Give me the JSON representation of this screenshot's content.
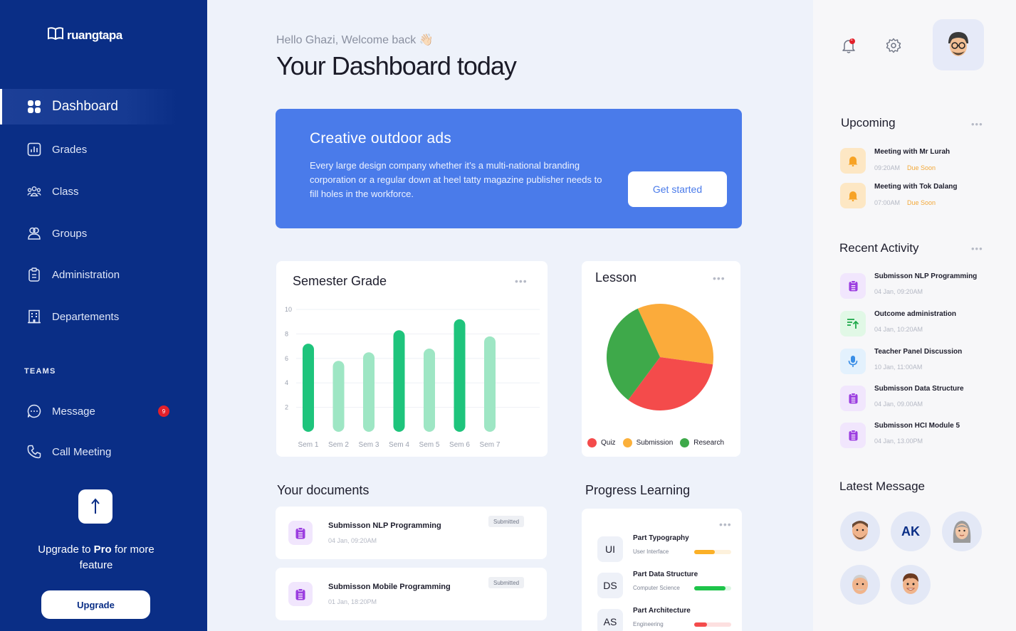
{
  "app": {
    "logo_text": "ruangtapa"
  },
  "sidebar": {
    "items": [
      {
        "label": "Dashboard",
        "icon": "grid-icon",
        "active": true
      },
      {
        "label": "Grades",
        "icon": "bar-chart-icon"
      },
      {
        "label": "Class",
        "icon": "people-icon"
      },
      {
        "label": "Groups",
        "icon": "users-icon"
      },
      {
        "label": "Administration",
        "icon": "clipboard-icon"
      },
      {
        "label": "Departements",
        "icon": "building-icon"
      }
    ],
    "teams_label": "TEAMS",
    "teams": [
      {
        "label": "Message",
        "icon": "chat-icon",
        "badge": "9"
      },
      {
        "label": "Call Meeting",
        "icon": "phone-icon"
      }
    ],
    "upgrade": {
      "text_prefix": "Upgrade to ",
      "text_bold": "Pro",
      "text_suffix": " for more feature",
      "button": "Upgrade"
    }
  },
  "header": {
    "greeting": "Hello Ghazi, Welcome back 👋🏻",
    "title": "Your Dashboard today"
  },
  "banner": {
    "title": "Creative outdoor ads",
    "body": "Every large design company whether it’s a multi-national branding corporation or a regular down at heel tatty magazine publisher needs to fill holes in the workforce.",
    "button": "Get started",
    "color": "#4a7bea"
  },
  "semester_card": {
    "title": "Semester Grade"
  },
  "lesson_card": {
    "title": "Lesson",
    "legend": [
      {
        "label": "Quiz",
        "color": "#f44b4b"
      },
      {
        "label": "Submission",
        "color": "#fbb03b"
      },
      {
        "label": "Research",
        "color": "#3ea94a"
      }
    ]
  },
  "chart_data": [
    {
      "type": "bar",
      "title": "Semester Grade",
      "categories": [
        "Sem 1",
        "Sem 2",
        "Sem 3",
        "Sem 4",
        "Sem 5",
        "Sem 6",
        "Sem 7"
      ],
      "values": [
        7.2,
        5.8,
        6.5,
        8.3,
        6.8,
        9.2,
        7.8
      ],
      "yticks": [
        2,
        4,
        6,
        8,
        10
      ],
      "ylim": [
        0,
        10
      ],
      "bar_colors": [
        "#1ec47c",
        "#9ee6c4",
        "#9ee6c4",
        "#1ec47c",
        "#9ee6c4",
        "#1ec47c",
        "#9ee6c4"
      ],
      "grid": true
    },
    {
      "type": "pie",
      "title": "Lesson",
      "labels": [
        "Submission",
        "Quiz",
        "Research"
      ],
      "values": [
        34,
        33,
        33
      ],
      "colors": [
        "#fbab3b",
        "#f44b4b",
        "#3ea94a"
      ],
      "legend_position": "bottom"
    }
  ],
  "documents": {
    "title": "Your documents",
    "items": [
      {
        "name": "Submisson NLP Programming",
        "date": "04 Jan, 09:20AM",
        "status": "Submitted"
      },
      {
        "name": "Submisson Mobile Programming",
        "date": "01 Jan, 18:20PM",
        "status": "Submitted"
      }
    ]
  },
  "progress": {
    "title": "Progress Learning",
    "items": [
      {
        "abbr": "UI",
        "name": "Part Typography",
        "sub": "User Interface",
        "progress": 0.55,
        "color": "#fbb027",
        "track": "#fdf1dc"
      },
      {
        "abbr": "DS",
        "name": "Part Data Structure",
        "sub": "Computer Science",
        "progress": 0.85,
        "color": "#1ec44a",
        "track": "#dcf7e3"
      },
      {
        "abbr": "AS",
        "name": "Part Architecture",
        "sub": "Engineering",
        "progress": 0.35,
        "color": "#f44b4b",
        "track": "#fde0e0"
      }
    ]
  },
  "right": {
    "notification_badge": "1",
    "upcoming": {
      "title": "Upcoming",
      "items": [
        {
          "name": "Meeting with Mr Lurah",
          "time": "09:20AM",
          "due": "Due Soon"
        },
        {
          "name": "Meeting with Tok Dalang",
          "time": "07:00AM",
          "due": "Due Soon"
        }
      ]
    },
    "recent": {
      "title": "Recent Activity",
      "items": [
        {
          "name": "Submisson NLP Programming",
          "date": "04 Jan, 09:20AM",
          "icon": "clipboard-icon",
          "bg": "#f1e6fd",
          "fg": "#9b3de0"
        },
        {
          "name": "Outcome administration",
          "date": "04 Jan, 10:20AM",
          "icon": "upload-list-icon",
          "bg": "#e1f8e6",
          "fg": "#1ea84a"
        },
        {
          "name": "Teacher Panel Discussion",
          "date": "10 Jan, 11:00AM",
          "icon": "microphone-icon",
          "bg": "#e3f1fd",
          "fg": "#3a8ee6"
        },
        {
          "name": "Submisson Data Structure",
          "date": "04 Jan, 09.00AM",
          "icon": "clipboard-icon",
          "bg": "#f1e6fd",
          "fg": "#9b3de0"
        },
        {
          "name": "Submisson HCI Module 5",
          "date": "04 Jan, 13.00PM",
          "icon": "clipboard-icon",
          "bg": "#f1e6fd",
          "fg": "#9b3de0"
        }
      ]
    },
    "latest": {
      "title": "Latest Message",
      "avatars": [
        {
          "type": "image",
          "icon": "man-beard-avatar"
        },
        {
          "type": "initials",
          "text": "AK"
        },
        {
          "type": "image",
          "icon": "woman-avatar"
        },
        {
          "type": "image",
          "icon": "old-man-avatar"
        },
        {
          "type": "image",
          "icon": "boy-avatar"
        }
      ]
    }
  }
}
